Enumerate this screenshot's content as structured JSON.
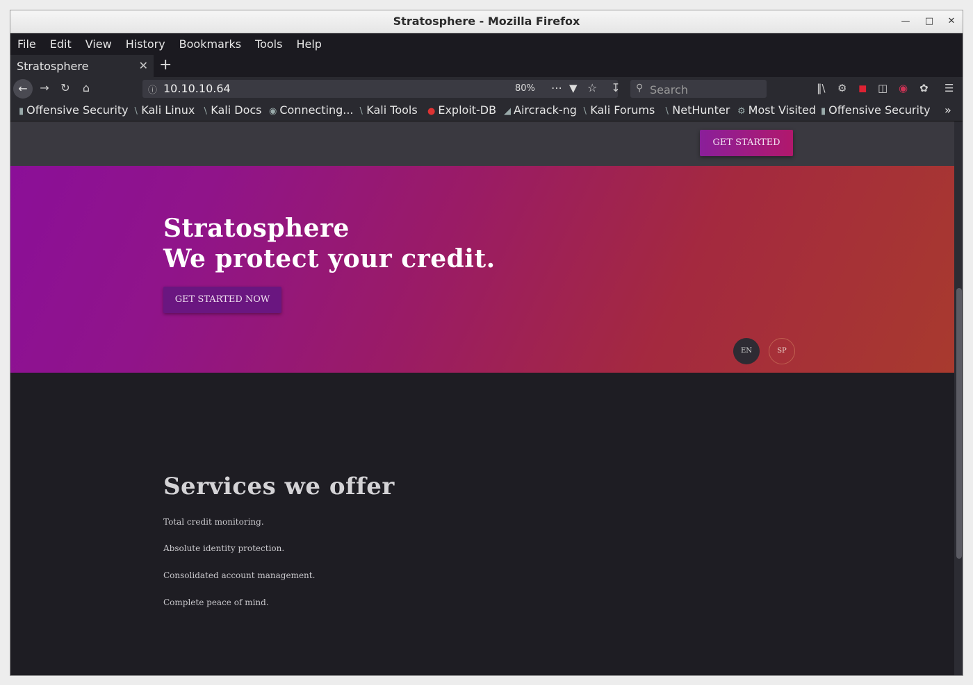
{
  "window": {
    "title": "Stratosphere - Mozilla Firefox"
  },
  "menu": [
    "File",
    "Edit",
    "View",
    "History",
    "Bookmarks",
    "Tools",
    "Help"
  ],
  "tab": {
    "label": "Stratosphere"
  },
  "navbar": {
    "url": "10.10.10.64",
    "zoom": "80%",
    "search_placeholder": "Search"
  },
  "bookmarks": [
    "Offensive Security",
    "Kali Linux",
    "Kali Docs",
    "Connecting...",
    "Kali Tools",
    "Exploit-DB",
    "Aircrack-ng",
    "Kali Forums",
    "NetHunter",
    "Most Visited",
    "Offensive Security"
  ],
  "page": {
    "top_button": "GET STARTED",
    "hero_line1": "Stratosphere",
    "hero_line2": "We protect your credit.",
    "hero_button": "GET STARTED NOW",
    "lang_en": "EN",
    "lang_sp": "SP",
    "services_title": "Services we offer",
    "services": [
      "Total credit monitoring.",
      "Absolute identity protection.",
      "Consolidated account management.",
      "Complete peace of mind."
    ]
  },
  "colors": {
    "hero_start": "#8b0f98",
    "hero_end": "#a83a2e",
    "page_bg": "#1e1d23",
    "accent": "#8a1f9a"
  }
}
